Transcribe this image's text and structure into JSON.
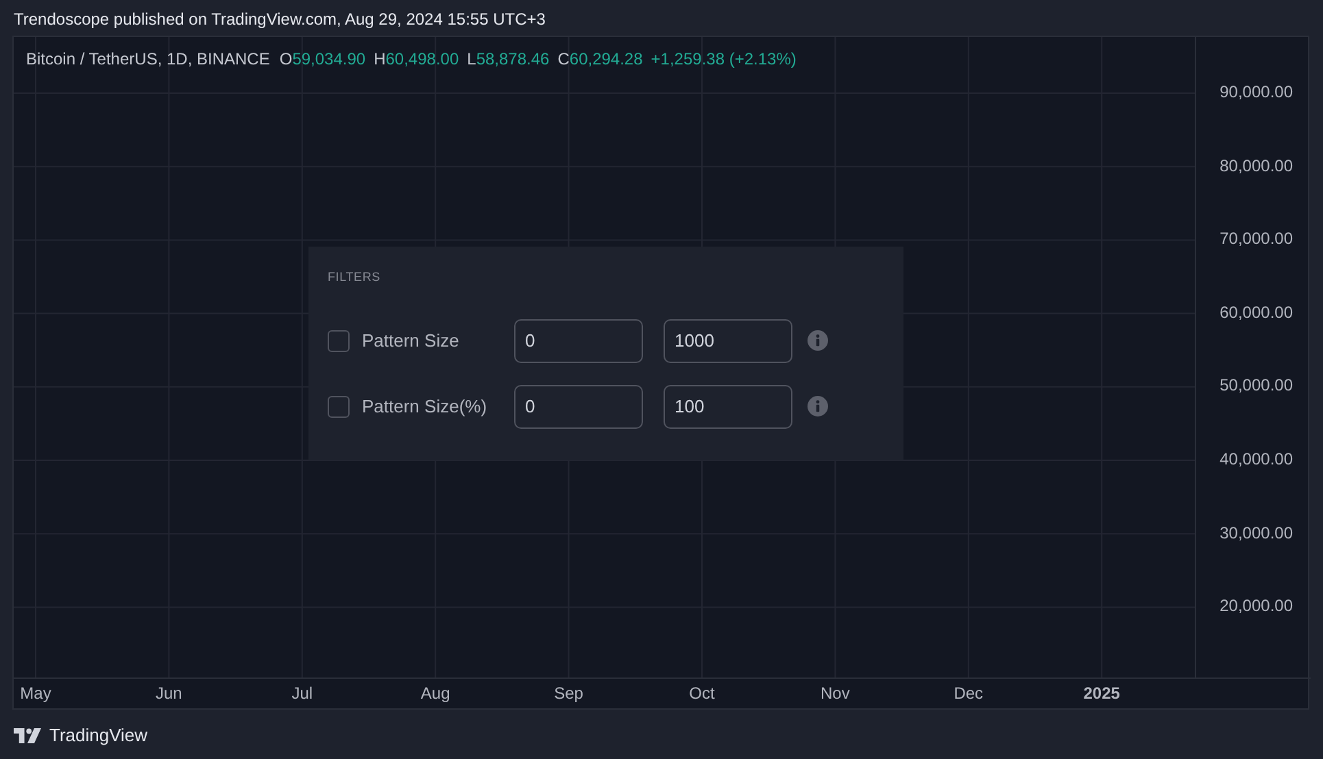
{
  "attribution": "Trendoscope published on TradingView.com, Aug 29, 2024 15:55 UTC+3",
  "legend": {
    "symbol": "Bitcoin / TetherUS, 1D, BINANCE",
    "ohlc": [
      {
        "label": "O",
        "value": "59,034.90"
      },
      {
        "label": "H",
        "value": "60,498.00"
      },
      {
        "label": "L",
        "value": "58,878.46"
      },
      {
        "label": "C",
        "value": "60,294.28"
      }
    ],
    "change": "+1,259.38 (+2.13%)"
  },
  "price_axis": [
    "90,000.00",
    "80,000.00",
    "70,000.00",
    "60,000.00",
    "50,000.00",
    "40,000.00",
    "30,000.00",
    "20,000.00"
  ],
  "time_axis": [
    {
      "label": "May",
      "bold": false
    },
    {
      "label": "Jun",
      "bold": false
    },
    {
      "label": "Jul",
      "bold": false
    },
    {
      "label": "Aug",
      "bold": false
    },
    {
      "label": "Sep",
      "bold": false
    },
    {
      "label": "Oct",
      "bold": false
    },
    {
      "label": "Nov",
      "bold": false
    },
    {
      "label": "Dec",
      "bold": false
    },
    {
      "label": "2025",
      "bold": true
    }
  ],
  "filters": {
    "title": "FILTERS",
    "rows": [
      {
        "label": "Pattern Size",
        "checked": false,
        "min": "0",
        "max": "1000"
      },
      {
        "label": "Pattern Size(%)",
        "checked": false,
        "min": "0",
        "max": "100"
      }
    ]
  },
  "footer": {
    "brand": "TradingView"
  }
}
